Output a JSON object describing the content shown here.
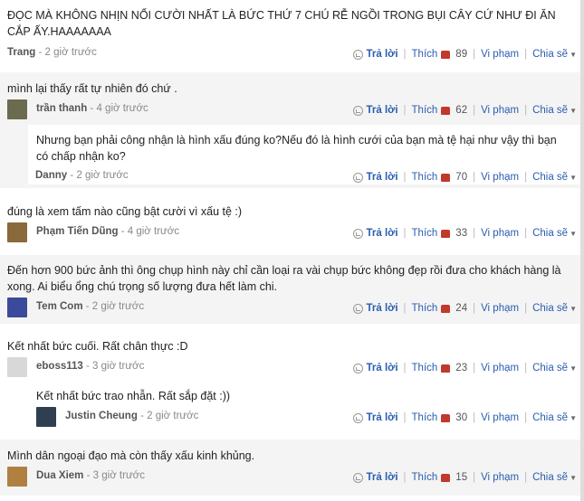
{
  "actions": {
    "reply": "Trả lời",
    "like": "Thích",
    "report": "Vi phạm",
    "share": "Chia sẽ"
  },
  "comments": [
    {
      "text": "ĐỌC MÀ KHÔNG NHỊN NỔI CƯỜI NHẤT LÀ BỨC THỨ 7 CHÚ RỄ NGỒI TRONG BỤI CÂY CỨ NHƯ ĐI ĂN CẮP ẤY.HAAAAAAA",
      "author": "Trang",
      "time": "- 2 giờ trước",
      "likes": "89"
    },
    {
      "text": "mình lại thấy rất tự nhiên đó chứ .",
      "author": "trần thanh",
      "time": "- 4 giờ trước",
      "likes": "62",
      "avatar_color": "#6b6b4f"
    },
    {
      "text": "Nhưng bạn phải công nhận là hình xấu đúng ko?Nếu đó là hình cưới của bạn mà tệ hại như vậy thì bạn có chấp nhận ko?",
      "author": "Danny",
      "time": "- 2 giờ trước",
      "likes": "70"
    },
    {
      "text": "đúng là xem tấm nào cũng bật cười vì xấu tệ :)",
      "author": "Phạm Tiến Dũng",
      "time": "- 4 giờ trước",
      "likes": "33",
      "avatar_color": "#8a6a3a"
    },
    {
      "text": "Đến hơn 900 bức ảnh thì ông chụp hình này chỉ cần loại ra vài chụp bức không đẹp rồi đưa cho khách hàng là xong. Ai biểu ổng chú trọng số lượng đưa hết làm chi.",
      "author": "Tem Com",
      "time": "- 2 giờ trước",
      "likes": "24",
      "avatar_color": "#3b4a9a"
    },
    {
      "text": "Kết nhất bức cuối. Rất chân thực :D",
      "author": "eboss113",
      "time": "- 3 giờ trước",
      "likes": "23",
      "avatar_color": "#d8d8d8"
    },
    {
      "text": "Kết nhất bức trao nhẫn. Rất sắp đặt :))",
      "author": "Justin Cheung",
      "time": "- 2 giờ trước",
      "likes": "30",
      "avatar_color": "#2f3f4f"
    },
    {
      "text": "Mình dân ngoại đạo mà còn thấy xấu kinh khủng.",
      "author": "Dua Xiem",
      "time": "- 3 giờ trước",
      "likes": "15",
      "avatar_color": "#b08040"
    }
  ]
}
